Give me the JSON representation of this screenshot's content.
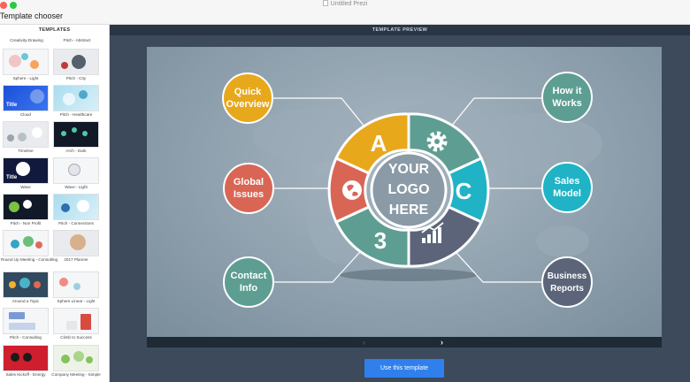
{
  "window": {
    "doc_title": "Untitled Prezi",
    "dialog_title": "Template chooser"
  },
  "sidebar": {
    "header": "TEMPLATES",
    "top_labels": [
      "Creativity-Drawing",
      "Pitch - Abstract"
    ],
    "templates": [
      {
        "label": "Sphere - Light"
      },
      {
        "label": "Pitch - City"
      },
      {
        "label": "Cloud",
        "thumb_text": "Title"
      },
      {
        "label": "Pitch - Healthcare"
      },
      {
        "label": "Timeline"
      },
      {
        "label": "Arch - Dark"
      },
      {
        "label": "Wave",
        "thumb_text": "Title"
      },
      {
        "label": "Wave - Light"
      },
      {
        "label": "Pitch - Non Profit"
      },
      {
        "label": "Pitch - Connections"
      },
      {
        "label": "Round Up Meeting - Consulting"
      },
      {
        "label": "2017 Planner"
      },
      {
        "label": "Around a Topic"
      },
      {
        "label": "Sphere Linear - Light"
      },
      {
        "label": "Pitch - Consulting"
      },
      {
        "label": "Climb to Success"
      },
      {
        "label": "Sales Kickoff - Energy"
      },
      {
        "label": "Company Meeting - Simple"
      }
    ]
  },
  "main": {
    "header": "TEMPLATE PREVIEW",
    "use_button": "Use this template",
    "nav_prev": "‹",
    "nav_next": "›"
  },
  "preview": {
    "center_label": [
      "YOUR",
      "LOGO",
      "HERE"
    ],
    "segment_a": "A",
    "segment_c": "C",
    "segment_3": "3",
    "circles": {
      "quick_overview": [
        "Quick",
        "Overview"
      ],
      "global_issues": [
        "Global",
        "Issues"
      ],
      "contact_info": [
        "Contact",
        "Info"
      ],
      "how_it_works": [
        "How it",
        "Works"
      ],
      "sales_model": [
        "Sales",
        "Model"
      ],
      "business_reports": [
        "Business",
        "Reports"
      ]
    },
    "colors": {
      "yellow": "#e8a81c",
      "teal": "#1fb3c5",
      "coral": "#d96655",
      "sage": "#5e9e92",
      "slate": "#5c6479",
      "ring": "#ffffff"
    }
  }
}
